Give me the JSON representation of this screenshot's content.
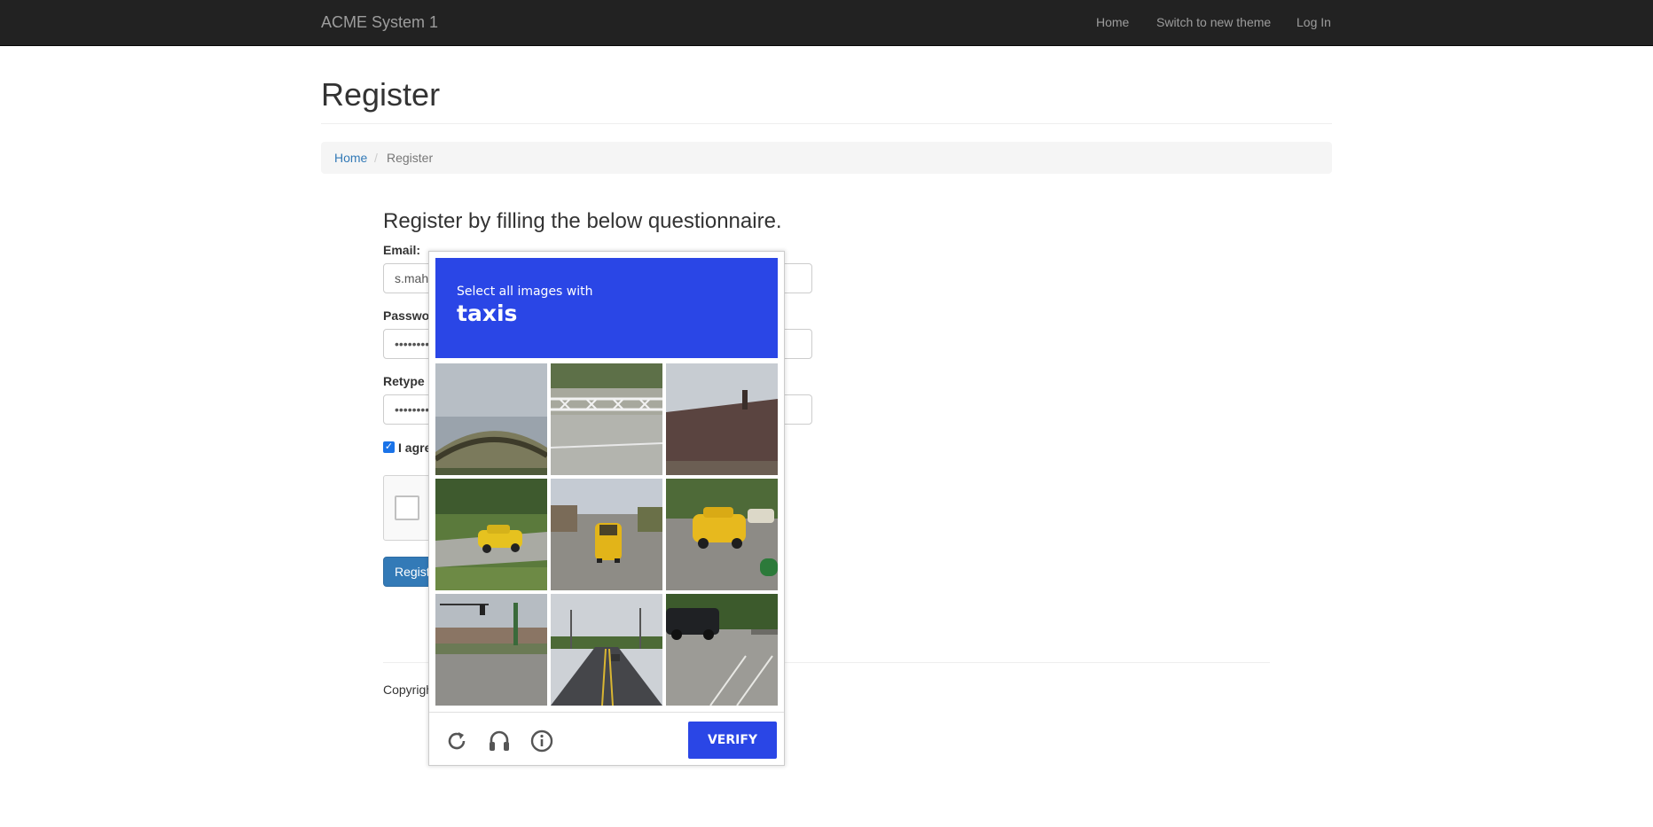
{
  "navbar": {
    "brand": "ACME System 1",
    "links": [
      "Home",
      "Switch to new theme",
      "Log In"
    ]
  },
  "page": {
    "title": "Register",
    "breadcrumb": {
      "home": "Home",
      "separator": "/",
      "current": "Register"
    }
  },
  "form": {
    "heading": "Register by filling the below questionnaire.",
    "email_label": "Email:",
    "email_value": "s.mah",
    "password_label": "Passwo",
    "password_value": "••••••••",
    "retype_label": "Retype",
    "retype_value": "••••••••",
    "agree_label": "I agre",
    "agree_checked": true,
    "register_label": "Regist",
    "copyright": "Copyrigh"
  },
  "captcha": {
    "instruction": "Select all images with",
    "target": "taxis",
    "verify_label": "VERIFY",
    "footer_icons": [
      "reload-icon",
      "audio-icon",
      "info-icon"
    ],
    "tiles": [
      "overpass-under-sky",
      "road-with-white-fence",
      "rooftop-with-chimney",
      "yellow-taxi-on-grass-road",
      "yellow-taxi-rear-street",
      "yellow-taxi-parking-lot",
      "intersection-with-buildings",
      "highway-with-car",
      "black-pickup-parking-lot"
    ],
    "accent_color": "#2a46e6"
  }
}
